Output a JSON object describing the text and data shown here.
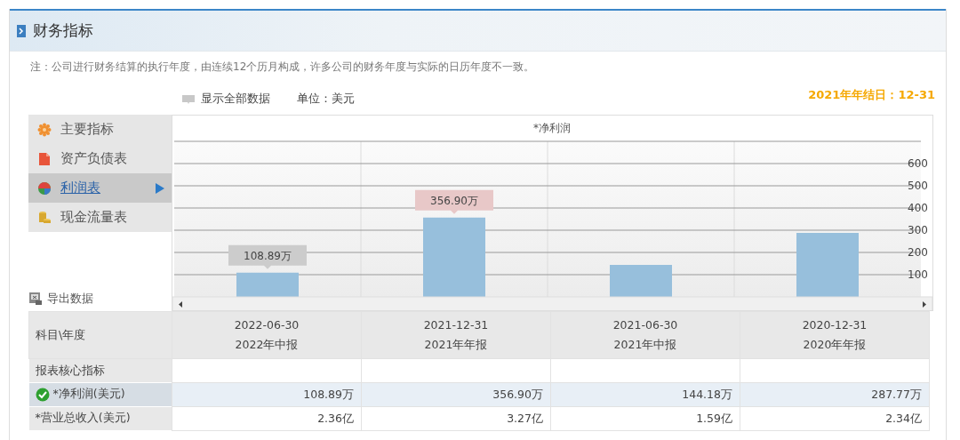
{
  "section": {
    "title": "财务指标"
  },
  "note": "注：公司进行财务结算的执行年度，由连续12个历月构成，许多公司的财务年度与实际的日历年度不一致。",
  "toolbar": {
    "show_all": "显示全部数据",
    "unit": "单位：美元",
    "fiscal_year_end": "2021年年结日：12-31"
  },
  "menu": [
    {
      "label": "主要指标",
      "kind": "gear",
      "selected": false
    },
    {
      "label": "资产负债表",
      "kind": "document",
      "selected": false
    },
    {
      "label": "利润表",
      "kind": "pie",
      "selected": true
    },
    {
      "label": "现金流量表",
      "kind": "coins",
      "selected": false
    }
  ],
  "export": "导出数据",
  "chart": {
    "chart_data": {
      "type": "bar",
      "title": "*净利润",
      "values": [
        109,
        357,
        144,
        288
      ],
      "ylim": [
        0,
        700
      ],
      "yticks": [
        100,
        200,
        300,
        400,
        500,
        600
      ],
      "grid": true,
      "annotations": [
        {
          "text": "108.89万",
          "y": 109
        },
        {
          "text": "356.90万",
          "y": 357
        }
      ]
    }
  },
  "table": {
    "corner": "科目\\年度",
    "columns": [
      {
        "date": "2022-06-30",
        "report": "2022年中报"
      },
      {
        "date": "2021-12-31",
        "report": "2021年年报"
      },
      {
        "date": "2021-06-30",
        "report": "2021年中报"
      },
      {
        "date": "2020-12-31",
        "report": "2020年年报"
      }
    ],
    "rows": [
      {
        "label": "报表核心指标",
        "selected": false
      },
      {
        "label": "*净利润(美元)",
        "selected": true,
        "cells": [
          "108.89万",
          "356.90万",
          "144.18万",
          "287.77万"
        ]
      },
      {
        "label": "*营业总收入(美元)",
        "selected": false,
        "cells": [
          "2.36亿",
          "3.27亿",
          "1.59亿",
          "2.34亿"
        ]
      }
    ]
  }
}
